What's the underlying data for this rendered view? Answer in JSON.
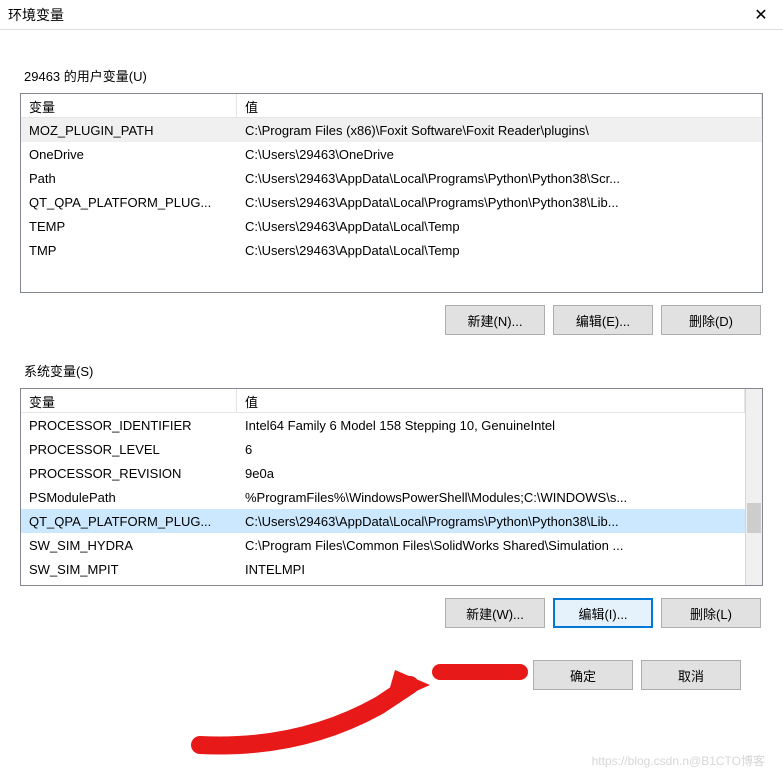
{
  "window": {
    "title": "环境变量"
  },
  "userVars": {
    "label": "29463 的用户变量(U)",
    "headers": {
      "variable": "变量",
      "value": "值"
    },
    "rows": [
      {
        "name": "MOZ_PLUGIN_PATH",
        "value": "C:\\Program Files (x86)\\Foxit Software\\Foxit Reader\\plugins\\",
        "selected": true
      },
      {
        "name": "OneDrive",
        "value": "C:\\Users\\29463\\OneDrive"
      },
      {
        "name": "Path",
        "value": "C:\\Users\\29463\\AppData\\Local\\Programs\\Python\\Python38\\Scr..."
      },
      {
        "name": "QT_QPA_PLATFORM_PLUG...",
        "value": "C:\\Users\\29463\\AppData\\Local\\Programs\\Python\\Python38\\Lib..."
      },
      {
        "name": "TEMP",
        "value": "C:\\Users\\29463\\AppData\\Local\\Temp"
      },
      {
        "name": "TMP",
        "value": "C:\\Users\\29463\\AppData\\Local\\Temp"
      }
    ],
    "buttons": {
      "new": "新建(N)...",
      "edit": "编辑(E)...",
      "delete": "删除(D)"
    }
  },
  "systemVars": {
    "label": "系统变量(S)",
    "headers": {
      "variable": "变量",
      "value": "值"
    },
    "rows": [
      {
        "name": "PROCESSOR_IDENTIFIER",
        "value": "Intel64 Family 6 Model 158 Stepping 10, GenuineIntel"
      },
      {
        "name": "PROCESSOR_LEVEL",
        "value": "6"
      },
      {
        "name": "PROCESSOR_REVISION",
        "value": "9e0a"
      },
      {
        "name": "PSModulePath",
        "value": "%ProgramFiles%\\WindowsPowerShell\\Modules;C:\\WINDOWS\\s..."
      },
      {
        "name": "QT_QPA_PLATFORM_PLUG...",
        "value": "C:\\Users\\29463\\AppData\\Local\\Programs\\Python\\Python38\\Lib...",
        "highlighted": true
      },
      {
        "name": "SW_SIM_HYDRA",
        "value": "C:\\Program Files\\Common Files\\SolidWorks Shared\\Simulation ..."
      },
      {
        "name": "SW_SIM_MPIT",
        "value": "INTELMPI"
      }
    ],
    "buttons": {
      "new": "新建(W)...",
      "edit": "编辑(I)...",
      "delete": "删除(L)"
    }
  },
  "dialog": {
    "ok": "确定",
    "cancel": "取消"
  },
  "watermark": "https://blog.csdn.n@B1CTO博客"
}
